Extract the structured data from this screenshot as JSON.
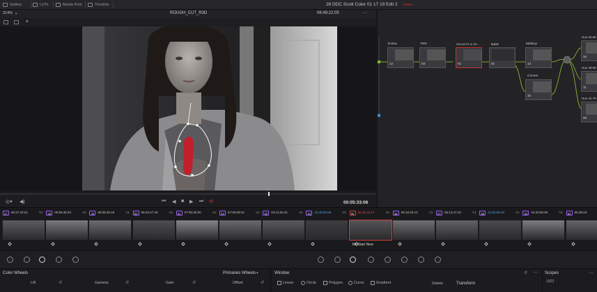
{
  "topbar": {
    "tabs": [
      {
        "label": "Gallery",
        "icon": "gallery-icon"
      },
      {
        "label": "LUTs",
        "icon": "luts-icon"
      },
      {
        "label": "Media Pool",
        "icon": "media-pool-icon"
      },
      {
        "label": "Timeline",
        "icon": "timeline-icon"
      }
    ],
    "project_title": "26 DDC Scott Color 01 17 19  Edit 2",
    "project_badge": "Edited"
  },
  "viewer": {
    "zoom": "214%",
    "clip_name": "ROUGH_CUT_R3D",
    "timecode": "06:49:22:05"
  },
  "transport": {
    "timecode": "00:05:33:06"
  },
  "nodes": [
    {
      "label": "B-Box",
      "number": "12"
    },
    {
      "label": "TNR",
      "number": "03"
    },
    {
      "label": "Master/Hue 69...",
      "number": "01"
    },
    {
      "label": "B&W",
      "number": "02"
    },
    {
      "label": "MidExp",
      "number": "14"
    },
    {
      "label": "Curves",
      "number": "15"
    },
    {
      "label": "Hue 53.90",
      "number": "10"
    },
    {
      "label": "Hue 49.80",
      "number": "11"
    },
    {
      "label": "Hue 41.70",
      "number": "05"
    }
  ],
  "timeline": {
    "clips": [
      {
        "num": "47",
        "tc": "00:47:20:22",
        "track": "V1"
      },
      {
        "num": "48",
        "tc": "05:55:45:23",
        "track": "V1"
      },
      {
        "num": "49",
        "tc": "08:38:36:18",
        "track": "V1"
      },
      {
        "num": "50",
        "tc": "06:26:47:18",
        "track": "V1"
      },
      {
        "num": "51",
        "tc": "07:00:35:00",
        "track": "V1"
      },
      {
        "num": "52",
        "tc": "07:08:59:22",
        "track": "V1"
      },
      {
        "num": "53",
        "tc": "03:13:52:21",
        "track": "V1"
      },
      {
        "num": "54",
        "tc": "22:48:32:06",
        "track": "V1"
      },
      {
        "num": "55",
        "tc": "06:49:16:17",
        "track": "V1"
      },
      {
        "num": "56",
        "tc": "06:10:26:13",
        "track": "V1"
      },
      {
        "num": "57",
        "tc": "06:13:47:10",
        "track": "V1"
      },
      {
        "num": "58",
        "tc": "21:51:58:18",
        "track": "V1"
      },
      {
        "num": "59",
        "tc": "04:40:05:08",
        "track": "V1"
      },
      {
        "num": "60",
        "tc": "06:39:22:",
        "track": "V1"
      }
    ],
    "selected_clip_label": "ML Start New"
  },
  "panels": {
    "color_wheels": "Color Wheels",
    "primaries_wheels": "Primaries Wheels",
    "lift": "Lift",
    "gamma": "Gamma",
    "gain": "Gain",
    "offset": "Offset",
    "window": "Window",
    "window_tools": [
      "Linear",
      "Circle",
      "Polygon",
      "Curve",
      "Gradient"
    ],
    "delete": "Delete",
    "transform": "Transform",
    "scopes": "Scopes",
    "scope_value": "1023"
  }
}
